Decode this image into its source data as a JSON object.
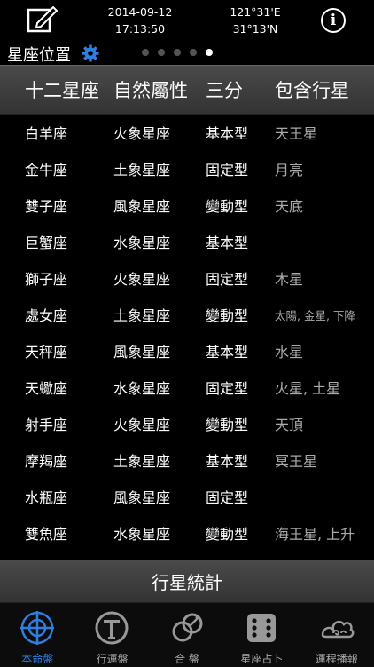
{
  "header": {
    "date": "2014-09-12",
    "time": "17:13:50",
    "longitude": "121°31'E",
    "latitude": "31°13'N",
    "info_glyph": "i"
  },
  "section": {
    "title": "星座位置"
  },
  "pager": {
    "count": 5,
    "active": 5
  },
  "table": {
    "columns": [
      "十二星座",
      "自然屬性",
      "三分",
      "包含行星"
    ],
    "rows": [
      [
        "白羊座",
        "火象星座",
        "基本型",
        "天王星"
      ],
      [
        "金牛座",
        "土象星座",
        "固定型",
        "月亮"
      ],
      [
        "雙子座",
        "風象星座",
        "變動型",
        "天底"
      ],
      [
        "巨蟹座",
        "水象星座",
        "基本型",
        ""
      ],
      [
        "獅子座",
        "火象星座",
        "固定型",
        "木星"
      ],
      [
        "處女座",
        "土象星座",
        "變動型",
        "太陽, 金星, 下降"
      ],
      [
        "天秤座",
        "風象星座",
        "基本型",
        "水星"
      ],
      [
        "天蠍座",
        "水象星座",
        "固定型",
        "火星, 土星"
      ],
      [
        "射手座",
        "火象星座",
        "變動型",
        "天頂"
      ],
      [
        "摩羯座",
        "土象星座",
        "基本型",
        "冥王星"
      ],
      [
        "水瓶座",
        "風象星座",
        "固定型",
        ""
      ],
      [
        "雙魚座",
        "水象星座",
        "變動型",
        "海王星, 上升"
      ]
    ]
  },
  "stats_button": "行星統計",
  "tabs": [
    {
      "label": "本命盤",
      "icon": "crosshair-icon",
      "active": true
    },
    {
      "label": "行運盤",
      "icon": "t-circle-icon",
      "active": false
    },
    {
      "label": "合 盤",
      "icon": "linked-circles-icon",
      "active": false
    },
    {
      "label": "星座占卜",
      "icon": "dice-icon",
      "active": false
    },
    {
      "label": "運程播報",
      "icon": "cloud-swirl-icon",
      "active": false
    }
  ],
  "colors": {
    "accent": "#2f7fe0",
    "background": "#000000"
  }
}
